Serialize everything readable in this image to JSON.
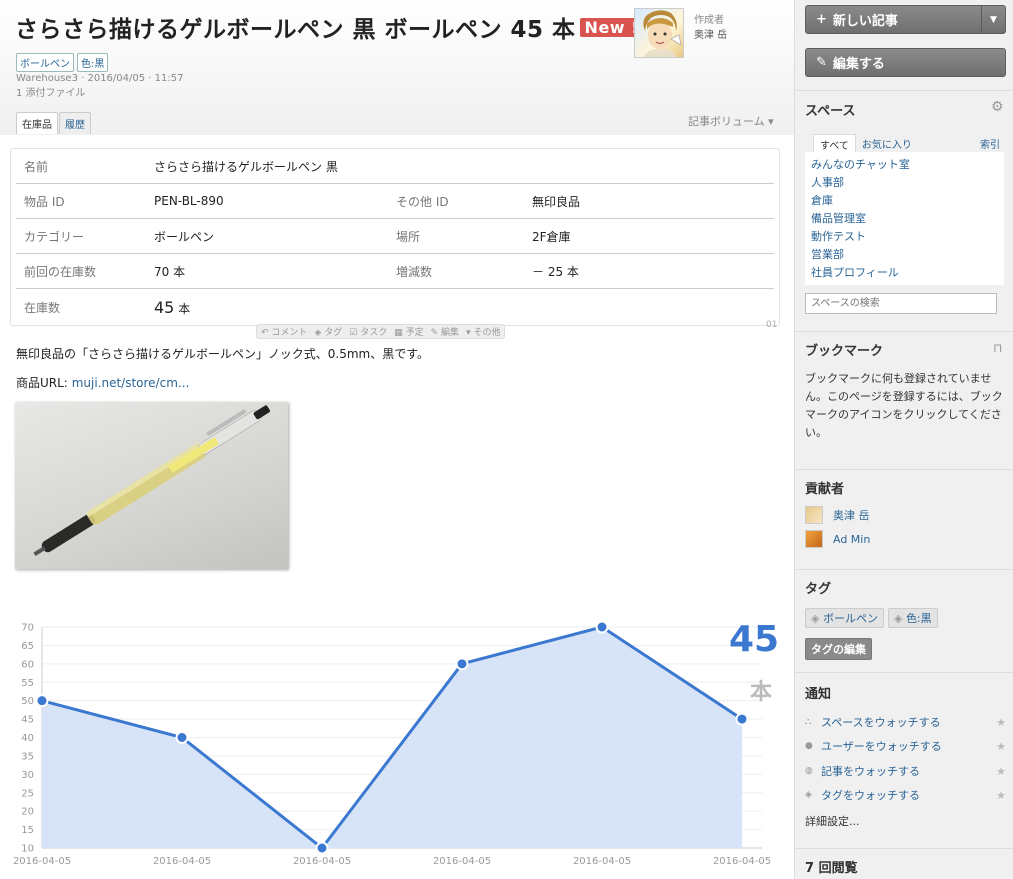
{
  "article": {
    "title": "さらさら描けるゲルボールペン 黒 ボールペン 45 本",
    "new_badge": "New !",
    "author_label": "作成者",
    "author_name": "奥津 岳",
    "tags": [
      "ボールペン",
      "色:黒"
    ],
    "meta_line1": "Warehouse3 · 2016/04/05 · 11:57",
    "meta_line2": "1 添付ファイル",
    "tabs": [
      "在庫品",
      "履歴"
    ],
    "volume": "記事ボリューム"
  },
  "item": {
    "name_label": "名前",
    "name_value": "さらさら描けるゲルボールペン 黒",
    "id_label": "物品 ID",
    "id_value": "PEN-BL-890",
    "other_id_label": "その他 ID",
    "other_id_value": "無印良品",
    "category_label": "カテゴリー",
    "category_value": "ボールペン",
    "place_label": "場所",
    "place_value": "2F倉庫",
    "prev_label": "前回の在庫数",
    "prev_value": "70 本",
    "delta_label": "増減数",
    "delta_value": "－ 25 本",
    "stock_label": "在庫数",
    "stock_number": "45",
    "stock_unit": "本",
    "row_num": "01"
  },
  "actions": [
    "コメント",
    "タグ",
    "タスク",
    "予定",
    "編集",
    "その他"
  ],
  "description": "無印良品の「さらさら描けるゲルボールペン」ノック式、0.5mm、黒です。",
  "url_label": "商品URL:",
  "url_text": "muji.net/store/cm...",
  "chart_data": {
    "type": "area",
    "x": [
      "2016-04-05",
      "2016-04-05",
      "2016-04-05",
      "2016-04-05",
      "2016-04-05",
      "2016-04-05"
    ],
    "series": [
      {
        "values": [
          50,
          40,
          10,
          60,
          70,
          45
        ]
      }
    ],
    "ylim": [
      10,
      70
    ],
    "yticks": [
      10,
      15,
      20,
      25,
      30,
      35,
      40,
      45,
      50,
      55,
      60,
      65,
      70
    ],
    "current_value": "45",
    "current_unit": "本",
    "line_color": "#3b78d0",
    "fill_color": "#d7e3f7",
    "grid": true
  },
  "sidebar": {
    "new_article": "新しい記事",
    "edit": "編集する",
    "space_head": "スペース",
    "space_tabs": [
      "すべて",
      "お気に入り"
    ],
    "space_index": "索引",
    "spaces": [
      "みんなのチャット室",
      "人事部",
      "倉庫",
      "備品管理室",
      "動作テスト",
      "営業部",
      "社員プロフィール"
    ],
    "space_search_placeholder": "スペースの検索",
    "bookmark_head": "ブックマーク",
    "bookmark_text": "ブックマークに何も登録されていません。このページを登録するには、ブックマークのアイコンをクリックしてください。",
    "contrib_head": "貢献者",
    "contributors": [
      "奥津 岳",
      "Ad Min"
    ],
    "tag_head": "タグ",
    "tags": [
      "ボールペン",
      "色:黒"
    ],
    "tag_edit": "タグの編集",
    "notify_head": "通知",
    "notifications": [
      "スペースをウォッチする",
      "ユーザーをウォッチする",
      "記事をウォッチする",
      "タグをウォッチする"
    ],
    "detail_link": "詳細設定...",
    "views": "7 回閲覧"
  }
}
